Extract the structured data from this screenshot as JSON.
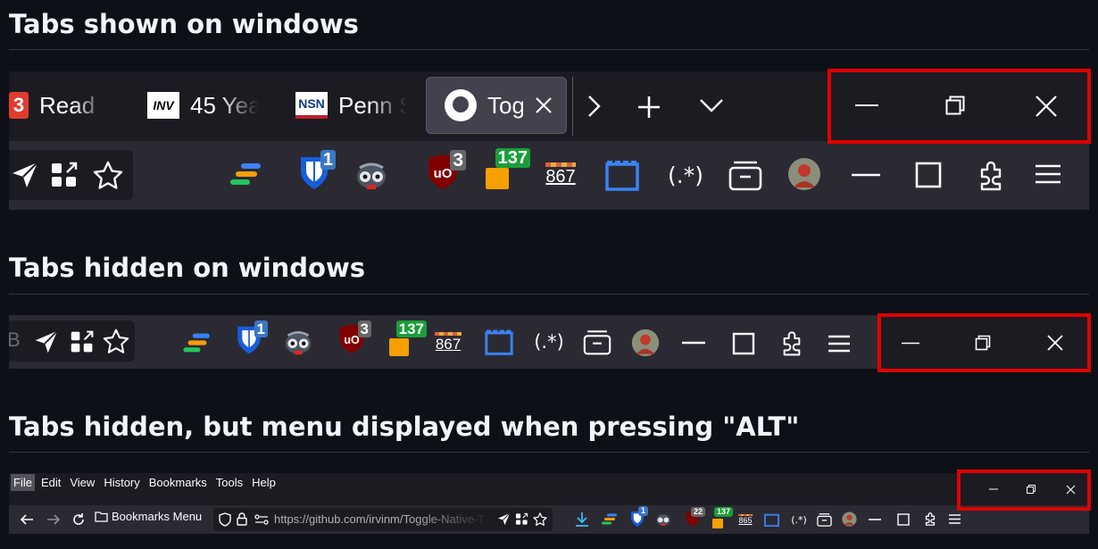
{
  "sections": {
    "shown": {
      "title": "Tabs shown on windows"
    },
    "hidden": {
      "title": "Tabs hidden on windows"
    },
    "alt": {
      "title": "Tabs hidden, but menu displayed when pressing \"ALT\""
    }
  },
  "tabs": [
    {
      "label": "Read",
      "favicon": "3"
    },
    {
      "label": "45 Yea",
      "favicon": "INV"
    },
    {
      "label": "Penn S",
      "favicon": "NSN"
    },
    {
      "label": "Togg",
      "favicon": "github-icon",
      "active": true
    }
  ],
  "badges": {
    "bitwarden": "1",
    "ublock": "3",
    "counter_green": "137",
    "abacus": "867",
    "ublock_small": "22",
    "abacus_small": "865"
  },
  "toolbar": {
    "regex_label": "(.*)",
    "bookmarks_menu": "Bookmarks Menu",
    "url": "https://github.com/irvinm/Toggle-Native-T",
    "bookmarks_partial": "B"
  },
  "menu": {
    "items": [
      "File",
      "Edit",
      "View",
      "History",
      "Bookmarks",
      "Tools",
      "Help"
    ]
  },
  "colors": {
    "highlight_box": "#e00000",
    "page_background": "#0d1117",
    "toolbar": "#2b2a33",
    "tabbar": "#1c1b22"
  }
}
